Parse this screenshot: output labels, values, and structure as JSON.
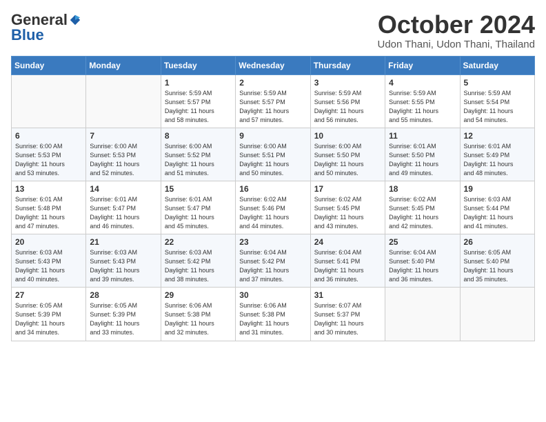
{
  "header": {
    "logo_general": "General",
    "logo_blue": "Blue",
    "month": "October 2024",
    "location": "Udon Thani, Udon Thani, Thailand"
  },
  "days_of_week": [
    "Sunday",
    "Monday",
    "Tuesday",
    "Wednesday",
    "Thursday",
    "Friday",
    "Saturday"
  ],
  "weeks": [
    [
      {
        "day": "",
        "info": ""
      },
      {
        "day": "",
        "info": ""
      },
      {
        "day": "1",
        "info": "Sunrise: 5:59 AM\nSunset: 5:57 PM\nDaylight: 11 hours\nand 58 minutes."
      },
      {
        "day": "2",
        "info": "Sunrise: 5:59 AM\nSunset: 5:57 PM\nDaylight: 11 hours\nand 57 minutes."
      },
      {
        "day": "3",
        "info": "Sunrise: 5:59 AM\nSunset: 5:56 PM\nDaylight: 11 hours\nand 56 minutes."
      },
      {
        "day": "4",
        "info": "Sunrise: 5:59 AM\nSunset: 5:55 PM\nDaylight: 11 hours\nand 55 minutes."
      },
      {
        "day": "5",
        "info": "Sunrise: 5:59 AM\nSunset: 5:54 PM\nDaylight: 11 hours\nand 54 minutes."
      }
    ],
    [
      {
        "day": "6",
        "info": "Sunrise: 6:00 AM\nSunset: 5:53 PM\nDaylight: 11 hours\nand 53 minutes."
      },
      {
        "day": "7",
        "info": "Sunrise: 6:00 AM\nSunset: 5:53 PM\nDaylight: 11 hours\nand 52 minutes."
      },
      {
        "day": "8",
        "info": "Sunrise: 6:00 AM\nSunset: 5:52 PM\nDaylight: 11 hours\nand 51 minutes."
      },
      {
        "day": "9",
        "info": "Sunrise: 6:00 AM\nSunset: 5:51 PM\nDaylight: 11 hours\nand 50 minutes."
      },
      {
        "day": "10",
        "info": "Sunrise: 6:00 AM\nSunset: 5:50 PM\nDaylight: 11 hours\nand 50 minutes."
      },
      {
        "day": "11",
        "info": "Sunrise: 6:01 AM\nSunset: 5:50 PM\nDaylight: 11 hours\nand 49 minutes."
      },
      {
        "day": "12",
        "info": "Sunrise: 6:01 AM\nSunset: 5:49 PM\nDaylight: 11 hours\nand 48 minutes."
      }
    ],
    [
      {
        "day": "13",
        "info": "Sunrise: 6:01 AM\nSunset: 5:48 PM\nDaylight: 11 hours\nand 47 minutes."
      },
      {
        "day": "14",
        "info": "Sunrise: 6:01 AM\nSunset: 5:47 PM\nDaylight: 11 hours\nand 46 minutes."
      },
      {
        "day": "15",
        "info": "Sunrise: 6:01 AM\nSunset: 5:47 PM\nDaylight: 11 hours\nand 45 minutes."
      },
      {
        "day": "16",
        "info": "Sunrise: 6:02 AM\nSunset: 5:46 PM\nDaylight: 11 hours\nand 44 minutes."
      },
      {
        "day": "17",
        "info": "Sunrise: 6:02 AM\nSunset: 5:45 PM\nDaylight: 11 hours\nand 43 minutes."
      },
      {
        "day": "18",
        "info": "Sunrise: 6:02 AM\nSunset: 5:45 PM\nDaylight: 11 hours\nand 42 minutes."
      },
      {
        "day": "19",
        "info": "Sunrise: 6:03 AM\nSunset: 5:44 PM\nDaylight: 11 hours\nand 41 minutes."
      }
    ],
    [
      {
        "day": "20",
        "info": "Sunrise: 6:03 AM\nSunset: 5:43 PM\nDaylight: 11 hours\nand 40 minutes."
      },
      {
        "day": "21",
        "info": "Sunrise: 6:03 AM\nSunset: 5:43 PM\nDaylight: 11 hours\nand 39 minutes."
      },
      {
        "day": "22",
        "info": "Sunrise: 6:03 AM\nSunset: 5:42 PM\nDaylight: 11 hours\nand 38 minutes."
      },
      {
        "day": "23",
        "info": "Sunrise: 6:04 AM\nSunset: 5:42 PM\nDaylight: 11 hours\nand 37 minutes."
      },
      {
        "day": "24",
        "info": "Sunrise: 6:04 AM\nSunset: 5:41 PM\nDaylight: 11 hours\nand 36 minutes."
      },
      {
        "day": "25",
        "info": "Sunrise: 6:04 AM\nSunset: 5:40 PM\nDaylight: 11 hours\nand 36 minutes."
      },
      {
        "day": "26",
        "info": "Sunrise: 6:05 AM\nSunset: 5:40 PM\nDaylight: 11 hours\nand 35 minutes."
      }
    ],
    [
      {
        "day": "27",
        "info": "Sunrise: 6:05 AM\nSunset: 5:39 PM\nDaylight: 11 hours\nand 34 minutes."
      },
      {
        "day": "28",
        "info": "Sunrise: 6:05 AM\nSunset: 5:39 PM\nDaylight: 11 hours\nand 33 minutes."
      },
      {
        "day": "29",
        "info": "Sunrise: 6:06 AM\nSunset: 5:38 PM\nDaylight: 11 hours\nand 32 minutes."
      },
      {
        "day": "30",
        "info": "Sunrise: 6:06 AM\nSunset: 5:38 PM\nDaylight: 11 hours\nand 31 minutes."
      },
      {
        "day": "31",
        "info": "Sunrise: 6:07 AM\nSunset: 5:37 PM\nDaylight: 11 hours\nand 30 minutes."
      },
      {
        "day": "",
        "info": ""
      },
      {
        "day": "",
        "info": ""
      }
    ]
  ]
}
